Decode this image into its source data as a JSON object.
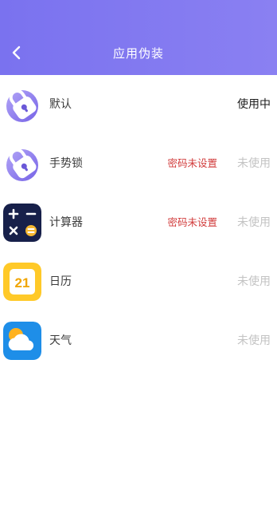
{
  "header": {
    "title": "应用伪装",
    "back_icon": "chevron-left-icon"
  },
  "colors": {
    "header": "#7a72ef",
    "warning": "#d13b3b",
    "inactive": "#c3c3c3"
  },
  "apps": [
    {
      "name": "默认",
      "icon": "lock-icon",
      "warning": "",
      "status": "使用中"
    },
    {
      "name": "手势锁",
      "icon": "lock-icon",
      "warning": "密码未设置",
      "status": "未使用"
    },
    {
      "name": "计算器",
      "icon": "calculator-icon",
      "warning": "密码未设置",
      "status": "未使用"
    },
    {
      "name": "日历",
      "icon": "calendar-icon",
      "calendar_day": "21",
      "warning": "",
      "status": "未使用"
    },
    {
      "name": "天气",
      "icon": "weather-icon",
      "warning": "",
      "status": "未使用"
    }
  ]
}
